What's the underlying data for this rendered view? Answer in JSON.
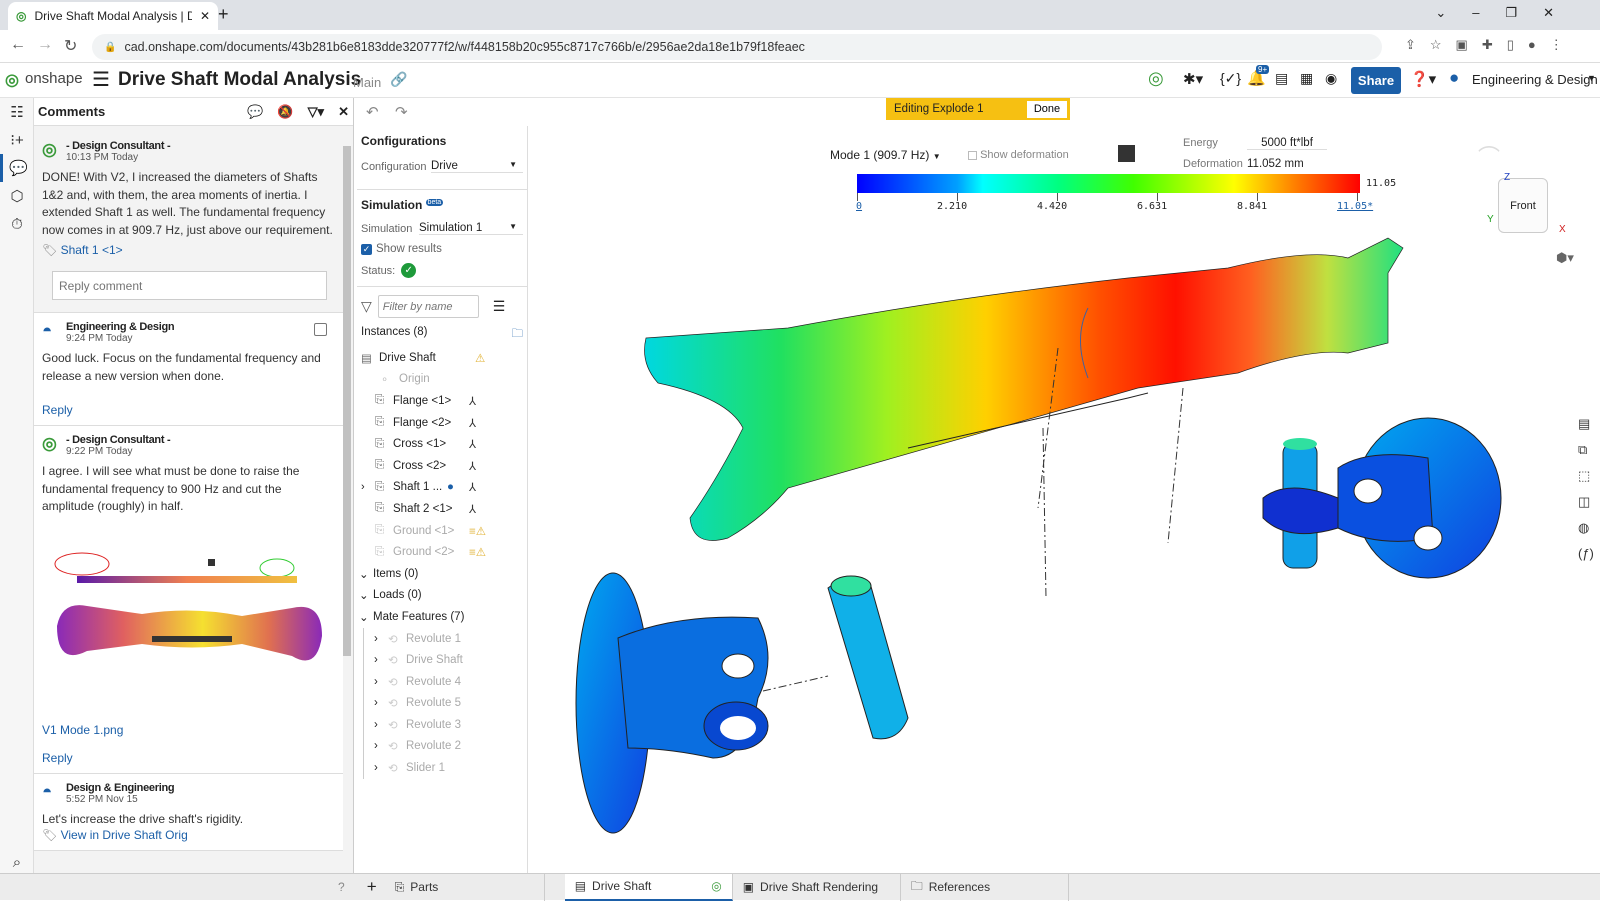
{
  "browser": {
    "tab_title": "Drive Shaft Modal Analysis | Dri",
    "url": "cad.onshape.com/documents/43b281b6e8183dde320777f2/w/f448158b20c955c8717c766b/e/2956ae2da18e1b79f18feaec"
  },
  "app": {
    "logo": "onshape",
    "doc_title": "Drive Shaft Modal Analysis",
    "branch": "Main",
    "share_label": "Share",
    "user": "Engineering & Design",
    "notif_badge": "9+",
    "accent": "#1b5fa8"
  },
  "comments": {
    "title": "Comments",
    "reply_placeholder": "Reply comment",
    "items": [
      {
        "author": "- Design Consultant -",
        "time": "10:13 PM Today",
        "text": "DONE!  With V2, I increased the diameters of Shafts 1&2 and, with them, the area moments of inertia.  I extended Shaft 1 as well.  The fundamental frequency now comes in at 909.7 Hz, just above our requirement.",
        "tag": "Shaft 1 <1>"
      },
      {
        "author": "Engineering & Design",
        "time": "9:24 PM Today",
        "text": "Good luck.  Focus on the fundamental frequency and release a new version when done.",
        "reply": "Reply"
      },
      {
        "author": "- Design Consultant -",
        "time": "9:22 PM Today",
        "text": "I agree.  I will see what must be done to raise the fundamental frequency to 900 Hz and cut the amplitude (roughly) in half.",
        "attachment": "V1 Mode 1.png",
        "reply": "Reply"
      },
      {
        "author": "Design & Engineering",
        "time": "5:52 PM Nov 15",
        "text": "Let's increase the drive shaft's rigidity.",
        "tag": "View in Drive Shaft Orig"
      }
    ]
  },
  "config": {
    "configurations_title": "Configurations",
    "configuration_label": "Configuration",
    "configuration_value": "Drive",
    "simulation_title": "Simulation",
    "beta": "beta",
    "simulation_label": "Simulation",
    "simulation_value": "Simulation 1",
    "show_results": "Show results",
    "status_label": "Status:",
    "filter_placeholder": "Filter by name",
    "instances_title": "Instances (8)",
    "instances": [
      {
        "name": "Drive Shaft",
        "dim": false
      },
      {
        "name": "Origin",
        "dim": true
      },
      {
        "name": "Flange <1>",
        "dim": false
      },
      {
        "name": "Flange <2>",
        "dim": false
      },
      {
        "name": "Cross <1>",
        "dim": false
      },
      {
        "name": "Cross <2>",
        "dim": false
      },
      {
        "name": "Shaft 1 ...",
        "dim": false
      },
      {
        "name": "Shaft 2 <1>",
        "dim": false
      },
      {
        "name": "Ground <1>",
        "dim": true
      },
      {
        "name": "Ground <2>",
        "dim": true
      }
    ],
    "items_title": "Items (0)",
    "loads_title": "Loads (0)",
    "mates_title": "Mate Features (7)",
    "mates": [
      "Revolute 1",
      "Drive Shaft",
      "Revolute 4",
      "Revolute 5",
      "Revolute 3",
      "Revolute 2",
      "Slider 1"
    ]
  },
  "viewport": {
    "explode_label": "Editing Explode 1",
    "done_label": "Done",
    "mode": "Mode 1 (909.7 Hz)",
    "show_deformation": "Show deformation",
    "energy_label": "Energy",
    "energy_value": "5000 ft*lbf",
    "deformation_label": "Deformation",
    "deformation_value": "11.052 mm",
    "legend_max": "11.05",
    "legend_ticks": [
      "0",
      "2.210",
      "4.420",
      "6.631",
      "8.841",
      "11.05*"
    ],
    "view_cube": "Front",
    "axes": {
      "x": "X",
      "y": "Y",
      "z": "Z"
    }
  },
  "bottom_tabs": [
    "Parts",
    "Drive Shaft",
    "Drive Shaft Rendering",
    "References"
  ]
}
